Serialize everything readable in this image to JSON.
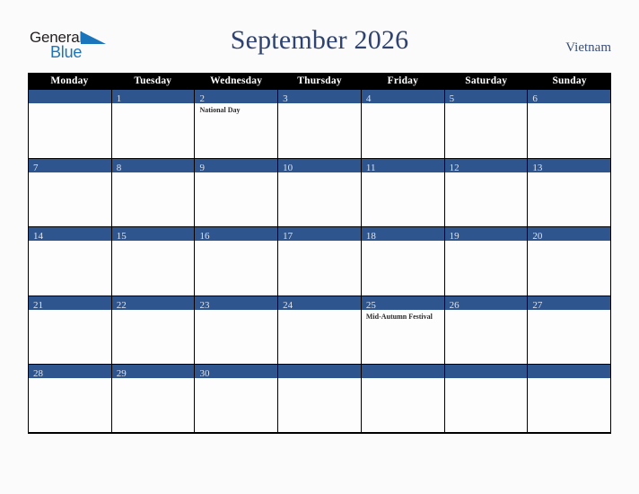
{
  "logo": {
    "word_one": "General",
    "word_two": "Blue",
    "flag_icon": "triangle-flag-icon",
    "brand_blue": "#1b75bb"
  },
  "header": {
    "title": "September 2026",
    "country": "Vietnam",
    "title_color": "#2e4372"
  },
  "calendar": {
    "accent_blue": "#2f558f",
    "header_background": "#000000",
    "weekday_headers": [
      "Monday",
      "Tuesday",
      "Wednesday",
      "Thursday",
      "Friday",
      "Saturday",
      "Sunday"
    ],
    "weeks": [
      [
        {
          "date": "",
          "events": []
        },
        {
          "date": "1",
          "events": []
        },
        {
          "date": "2",
          "events": [
            "National Day"
          ]
        },
        {
          "date": "3",
          "events": []
        },
        {
          "date": "4",
          "events": []
        },
        {
          "date": "5",
          "events": []
        },
        {
          "date": "6",
          "events": []
        }
      ],
      [
        {
          "date": "7",
          "events": []
        },
        {
          "date": "8",
          "events": []
        },
        {
          "date": "9",
          "events": []
        },
        {
          "date": "10",
          "events": []
        },
        {
          "date": "11",
          "events": []
        },
        {
          "date": "12",
          "events": []
        },
        {
          "date": "13",
          "events": []
        }
      ],
      [
        {
          "date": "14",
          "events": []
        },
        {
          "date": "15",
          "events": []
        },
        {
          "date": "16",
          "events": []
        },
        {
          "date": "17",
          "events": []
        },
        {
          "date": "18",
          "events": []
        },
        {
          "date": "19",
          "events": []
        },
        {
          "date": "20",
          "events": []
        }
      ],
      [
        {
          "date": "21",
          "events": []
        },
        {
          "date": "22",
          "events": []
        },
        {
          "date": "23",
          "events": []
        },
        {
          "date": "24",
          "events": []
        },
        {
          "date": "25",
          "events": [
            "Mid-Autumn Festival"
          ]
        },
        {
          "date": "26",
          "events": []
        },
        {
          "date": "27",
          "events": []
        }
      ],
      [
        {
          "date": "28",
          "events": []
        },
        {
          "date": "29",
          "events": []
        },
        {
          "date": "30",
          "events": []
        },
        {
          "date": "",
          "events": []
        },
        {
          "date": "",
          "events": []
        },
        {
          "date": "",
          "events": []
        },
        {
          "date": "",
          "events": []
        }
      ]
    ]
  }
}
